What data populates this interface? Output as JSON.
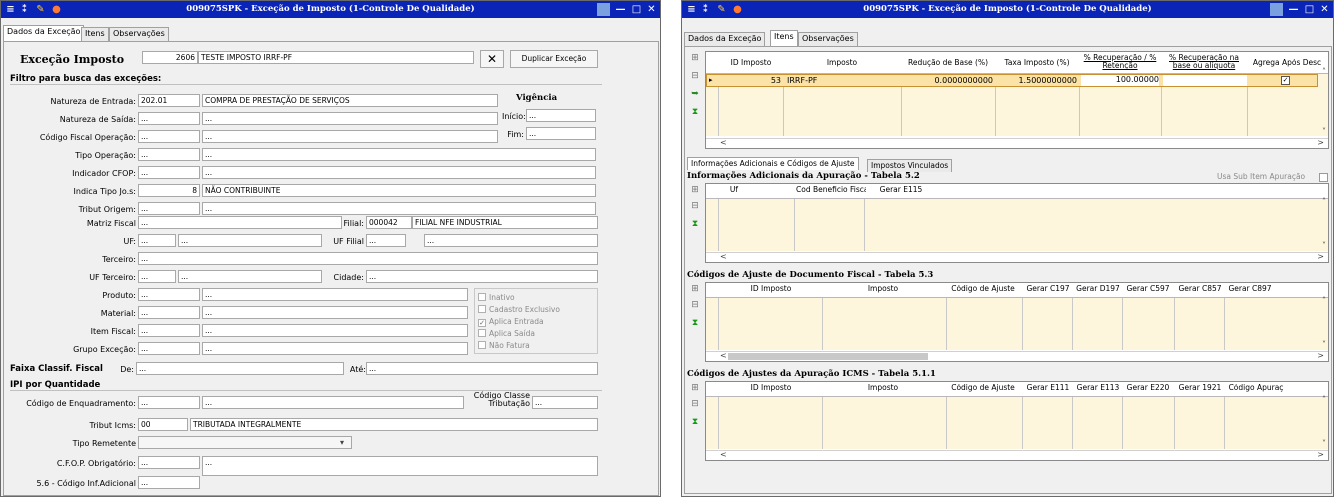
{
  "window1": {
    "title": "009075SPK - Exceção de Imposto (1-Controle De Qualidade)",
    "tabs": [
      "Dados da Exceção",
      "Itens",
      "Observações"
    ],
    "header": {
      "label": "Exceção Imposto",
      "code": "2606",
      "desc": "TESTE IMPOSTO IRRF-PF",
      "dup": "Duplicar Exceção"
    },
    "filter_title": "Filtro para busca das exceções:",
    "vigencia": {
      "title": "Vigência",
      "inicio": "Início:",
      "fim": "Fim:",
      "inicio_val": "...",
      "fim_val": "..."
    },
    "rows": [
      {
        "label": "Natureza de Entrada:",
        "code": "202.01",
        "desc": "COMPRA DE PRESTAÇÃO DE SERVIÇOS"
      },
      {
        "label": "Natureza de Saída:",
        "code": "...",
        "desc": "..."
      },
      {
        "label": "Código Fiscal Operação:",
        "code": "...",
        "desc": "..."
      },
      {
        "label": "Tipo Operação:",
        "code": "...",
        "desc": "..."
      },
      {
        "label": "Indicador CFOP:",
        "code": "...",
        "desc": "..."
      },
      {
        "label": "Indica Tipo Jo.s:",
        "code": "8",
        "desc": "NÃO CONTRIBUINTE"
      },
      {
        "label": "Tribut Origem:",
        "code": "...",
        "desc": "..."
      }
    ],
    "matriz": {
      "label": "Matriz Fiscal",
      "val": "...",
      "filial_lbl": "Filial:",
      "filial_code": "000042",
      "filial_desc": "FILIAL NFE INDUSTRIAL"
    },
    "uf": {
      "label": "UF:",
      "code": "...",
      "desc": "...",
      "uf_filial_lbl": "UF Filial",
      "uf_filial_code": "...",
      "uf_filial_desc": "..."
    },
    "terceiro": {
      "label": "Terceiro:",
      "val": "..."
    },
    "uf_terceiro": {
      "label": "UF Terceiro:",
      "code": "...",
      "desc": "...",
      "cidade_lbl": "Cidade:",
      "cidade_val": "..."
    },
    "rows2": [
      {
        "label": "Produto:",
        "code": "...",
        "desc": "..."
      },
      {
        "label": "Material:",
        "code": "...",
        "desc": "..."
      },
      {
        "label": "Item Fiscal:",
        "code": "...",
        "desc": "..."
      },
      {
        "label": "Grupo Exceção:",
        "code": "...",
        "desc": "..."
      }
    ],
    "checks": [
      {
        "label": "Inativo",
        "checked": false
      },
      {
        "label": "Cadastro Exclusivo",
        "checked": false
      },
      {
        "label": "Aplica Entrada",
        "checked": true
      },
      {
        "label": "Aplica Saída",
        "checked": false
      },
      {
        "label": "Não Fatura",
        "checked": false
      }
    ],
    "faixa": {
      "label": "Faixa Classif. Fiscal",
      "de": "De:",
      "de_val": "...",
      "ate": "Até:",
      "ate_val": "..."
    },
    "ipi_title": "IPI por Quantidade",
    "enq": {
      "label": "Código de Enquadramento:",
      "code": "...",
      "desc": "...",
      "classe_lbl": "Código Classe Tributação",
      "classe_val": "..."
    },
    "icms": {
      "label": "Tribut Icms:",
      "code": "00",
      "desc": "TRIBUTADA INTEGRALMENTE"
    },
    "remetente": {
      "label": "Tipo Remetente"
    },
    "cfop_obr": {
      "label": "C.F.O.P. Obrigatório:",
      "code": "...",
      "desc": "..."
    },
    "inf_adic": {
      "label": "5.6 - Código Inf.Adicional",
      "code": "..."
    }
  },
  "window2": {
    "title": "009075SPK - Exceção de Imposto (1-Controle De Qualidade)",
    "tabs": [
      "Dados da Exceção",
      "Itens",
      "Observações"
    ],
    "main_grid": {
      "headers": [
        "ID Imposto",
        "Imposto",
        "Redução de Base (%)",
        "Taxa Imposto (%)",
        "% Recuperação / % Retenção",
        "% Recuperação na base ou alíquota",
        "Agrega Após Desc"
      ],
      "row": {
        "id": "53",
        "imposto": "IRRF-PF",
        "reducao": "0.0000000000",
        "taxa": "1.5000000000",
        "recup": "100.00000",
        "agrega": true
      }
    },
    "subtabs": [
      "Informações Adicionais e Códigos de Ajuste",
      "Impostos Vinculados"
    ],
    "sec1": {
      "title": "Informações Adicionais da Apuração - Tabela 5.2",
      "usa_sub": "Usa Sub Item Apuração",
      "headers": [
        "Uf",
        "Cod Beneficio Fiscal",
        "Gerar E115"
      ]
    },
    "sec2": {
      "title": "Códigos de Ajuste de Documento Fiscal - Tabela 5.3",
      "headers": [
        "ID Imposto",
        "Imposto",
        "Código de Ajuste",
        "Gerar C197",
        "Gerar D197",
        "Gerar C597",
        "Gerar C857",
        "Gerar C897"
      ]
    },
    "sec3": {
      "title": "Códigos de Ajustes da Apuração ICMS - Tabela 5.1.1",
      "headers": [
        "ID Imposto",
        "Imposto",
        "Código de Ajuste",
        "Gerar E111",
        "Gerar E113",
        "Gerar E220",
        "Gerar 1921",
        "Código Apuraç"
      ]
    }
  },
  "colors": {
    "titlebar": "#0b24b8",
    "grid_body": "#fdf5dc",
    "selected_row": "#fbe2a6"
  }
}
